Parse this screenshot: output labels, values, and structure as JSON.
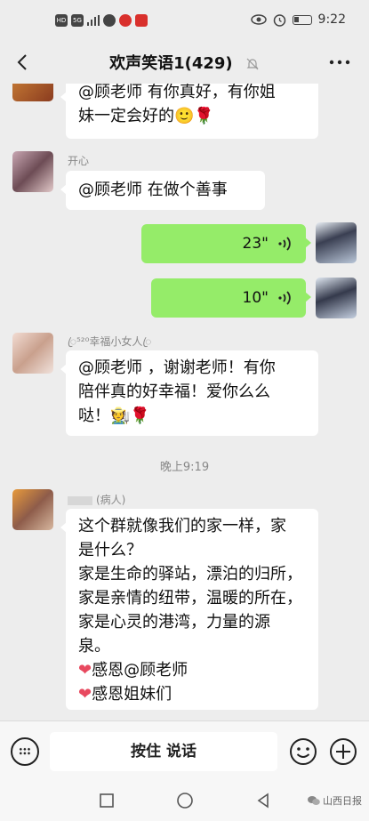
{
  "status_bar": {
    "time": "9:22",
    "left_icons": [
      "hd-icon",
      "signal-5g-icon",
      "signal-bars-icon",
      "app-icon",
      "weibo-icon",
      "news-icon"
    ],
    "right_icons": [
      "eye-icon",
      "alarm-icon",
      "battery-icon"
    ]
  },
  "header": {
    "title": "欢声笑语1(429)",
    "back_icon": "chevron-left-icon",
    "mute_icon": "bell-off-icon",
    "more_icon": "more-dots-icon"
  },
  "messages": [
    {
      "type": "in",
      "nick": "",
      "lines": [
        "@顾老师  有你真好，有你姐",
        "妹一定会好的🙂🌹"
      ]
    },
    {
      "type": "in",
      "nick": "开心",
      "lines": [
        "@顾老师  在做个善事"
      ]
    },
    {
      "type": "voice_out",
      "duration": "23\""
    },
    {
      "type": "voice_out",
      "duration": "10\""
    },
    {
      "type": "in",
      "nick": "ꦿ⁵²⁰幸福小女人ꦿ",
      "lines": [
        "@顾老师 ，谢谢老师！有你",
        "陪伴真的好幸福！爱你么么",
        "哒！🧑‍🌾🌹"
      ]
    },
    {
      "type": "time",
      "text": "晚上9:19"
    },
    {
      "type": "in",
      "nick": "(病人)",
      "lines": [
        "这个群就像我们的家一样，家",
        "是什么？",
        "家是生命的驿站，漂泊的归所，",
        "家是亲情的纽带，温暖的所在，",
        "家是心灵的港湾，力量的源",
        "泉。",
        "感恩@顾老师",
        "感恩姐妹们"
      ]
    }
  ],
  "input_bar": {
    "hold_to_talk": "按住 说话",
    "keyboard_icon": "keyboard-icon",
    "emoji_icon": "emoji-icon",
    "plus_icon": "plus-icon"
  },
  "nav_bar": {
    "icons": [
      "square-icon",
      "circle-icon",
      "triangle-back-icon"
    ],
    "watermark": "山西日报"
  },
  "colors": {
    "background": "#ededed",
    "bubble_out": "#95ec69",
    "bubble_in": "#ffffff",
    "heart": "#e8495f"
  }
}
